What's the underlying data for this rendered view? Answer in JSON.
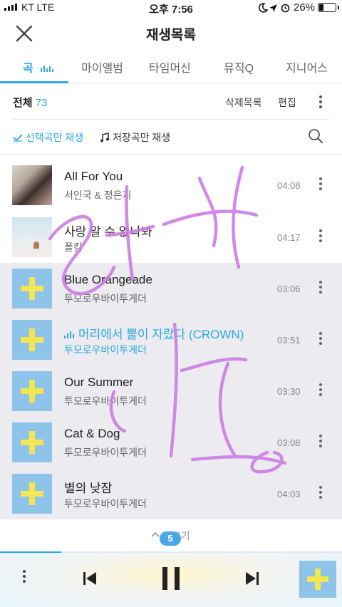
{
  "status": {
    "carrier": "KT  LTE",
    "time": "오후 7:56",
    "battery": "26%"
  },
  "header": {
    "title": "재생목록"
  },
  "tabs": [
    {
      "label": "곡"
    },
    {
      "label": "마이앨범"
    },
    {
      "label": "타임머신"
    },
    {
      "label": "뮤직Q"
    },
    {
      "label": "지니어스"
    }
  ],
  "toolbar": {
    "total_label": "전체",
    "total_count": "73",
    "delete_label": "삭제목록",
    "edit_label": "편집",
    "play_selected": "선택곡만 재생",
    "play_saved": "저장곡만 재생"
  },
  "songs": [
    {
      "title": "All For You",
      "artist": "서인국 & 정은지",
      "duration": "04:08"
    },
    {
      "title": "사랑 알 수 없나봐",
      "artist": "폴킴",
      "duration": "04:17"
    },
    {
      "title": "Blue Orangeade",
      "artist": "투모로우바이투게더",
      "duration": "03:06"
    },
    {
      "title": "머리에서 뿔이 자랐다 (CROWN)",
      "artist": "투모로우바이투게더",
      "duration": "03:51"
    },
    {
      "title": "Our Summer",
      "artist": "투모로우바이투게더",
      "duration": "03:30"
    },
    {
      "title": "Cat & Dog",
      "artist": "투모로우바이투게더",
      "duration": "03:08"
    },
    {
      "title": "별의 낮잠",
      "artist": "투모로우바이투게더",
      "duration": "04:03"
    }
  ],
  "footer": {
    "more_label": "더보기",
    "badge": "5"
  },
  "player": {
    "progress": 0.18
  },
  "colors": {
    "accent": "#2aa9e0",
    "selected_row": "#ebebf0",
    "scribble": "#cc7de6"
  }
}
